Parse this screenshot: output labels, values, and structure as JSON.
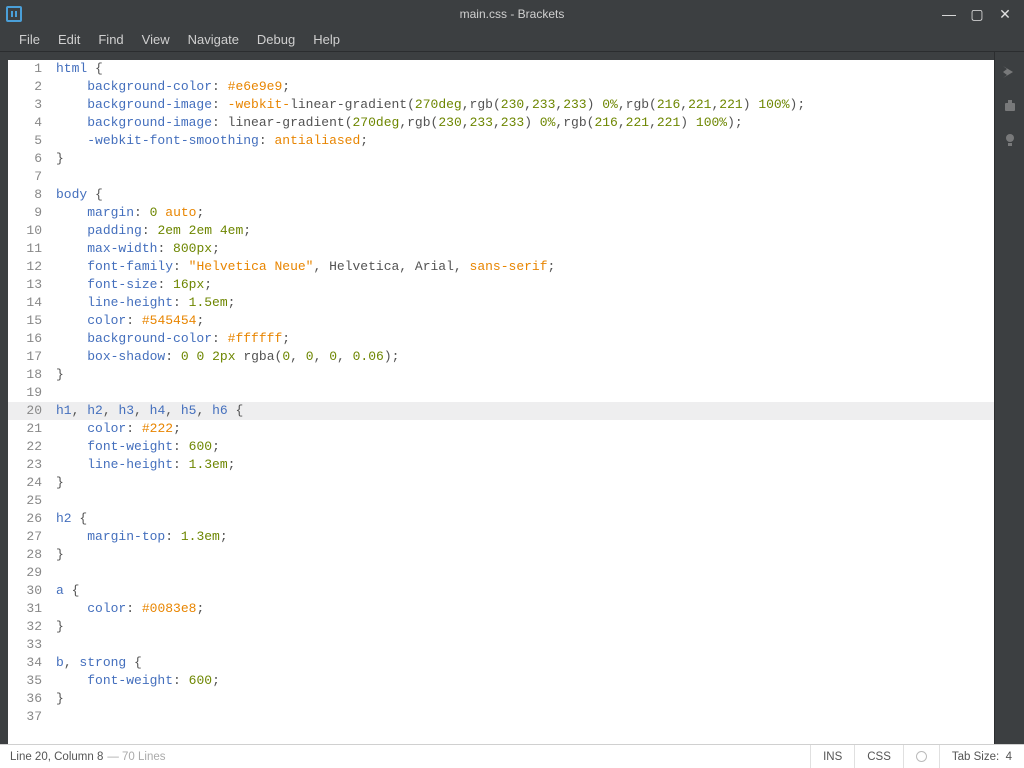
{
  "window": {
    "title": "main.css - Brackets"
  },
  "menu": [
    "File",
    "Edit",
    "Find",
    "View",
    "Navigate",
    "Debug",
    "Help"
  ],
  "side_icons": [
    "live-preview-icon",
    "extensions-icon",
    "lightbulb-icon"
  ],
  "status": {
    "cursor": "Line 20, Column 8",
    "lines_suffix": " — 70 Lines",
    "ins": "INS",
    "lang": "CSS",
    "tabsize_label": "Tab Size:",
    "tabsize_value": "4"
  },
  "editor": {
    "active_line": 20,
    "total_displayed": 37,
    "code": [
      [
        [
          "tag",
          "html"
        ],
        [
          "punc",
          " {"
        ]
      ],
      [
        [
          "punc",
          "    "
        ],
        [
          "prop",
          "background-color"
        ],
        [
          "punc",
          ": "
        ],
        [
          "atom",
          "#e6e9e9"
        ],
        [
          "punc",
          ";"
        ]
      ],
      [
        [
          "punc",
          "    "
        ],
        [
          "prop",
          "background-image"
        ],
        [
          "punc",
          ": "
        ],
        [
          "atom",
          "-webkit-"
        ],
        [
          "meta",
          "linear-gradient"
        ],
        [
          "punc",
          "("
        ],
        [
          "num",
          "270deg"
        ],
        [
          "punc",
          ","
        ],
        [
          "meta",
          "rgb"
        ],
        [
          "punc",
          "("
        ],
        [
          "num",
          "230"
        ],
        [
          "punc",
          ","
        ],
        [
          "num",
          "233"
        ],
        [
          "punc",
          ","
        ],
        [
          "num",
          "233"
        ],
        [
          "punc",
          ") "
        ],
        [
          "num",
          "0%"
        ],
        [
          "punc",
          ","
        ],
        [
          "meta",
          "rgb"
        ],
        [
          "punc",
          "("
        ],
        [
          "num",
          "216"
        ],
        [
          "punc",
          ","
        ],
        [
          "num",
          "221"
        ],
        [
          "punc",
          ","
        ],
        [
          "num",
          "221"
        ],
        [
          "punc",
          ") "
        ],
        [
          "num",
          "100%"
        ],
        [
          "punc",
          ");"
        ]
      ],
      [
        [
          "punc",
          "    "
        ],
        [
          "prop",
          "background-image"
        ],
        [
          "punc",
          ": "
        ],
        [
          "meta",
          "linear-gradient"
        ],
        [
          "punc",
          "("
        ],
        [
          "num",
          "270deg"
        ],
        [
          "punc",
          ","
        ],
        [
          "meta",
          "rgb"
        ],
        [
          "punc",
          "("
        ],
        [
          "num",
          "230"
        ],
        [
          "punc",
          ","
        ],
        [
          "num",
          "233"
        ],
        [
          "punc",
          ","
        ],
        [
          "num",
          "233"
        ],
        [
          "punc",
          ") "
        ],
        [
          "num",
          "0%"
        ],
        [
          "punc",
          ","
        ],
        [
          "meta",
          "rgb"
        ],
        [
          "punc",
          "("
        ],
        [
          "num",
          "216"
        ],
        [
          "punc",
          ","
        ],
        [
          "num",
          "221"
        ],
        [
          "punc",
          ","
        ],
        [
          "num",
          "221"
        ],
        [
          "punc",
          ") "
        ],
        [
          "num",
          "100%"
        ],
        [
          "punc",
          ");"
        ]
      ],
      [
        [
          "punc",
          "    "
        ],
        [
          "prop",
          "-webkit-font-smoothing"
        ],
        [
          "punc",
          ": "
        ],
        [
          "atom",
          "antialiased"
        ],
        [
          "punc",
          ";"
        ]
      ],
      [
        [
          "punc",
          "}"
        ]
      ],
      [],
      [
        [
          "tag",
          "body"
        ],
        [
          "punc",
          " {"
        ]
      ],
      [
        [
          "punc",
          "    "
        ],
        [
          "prop",
          "margin"
        ],
        [
          "punc",
          ": "
        ],
        [
          "num",
          "0"
        ],
        [
          "punc",
          " "
        ],
        [
          "atom",
          "auto"
        ],
        [
          "punc",
          ";"
        ]
      ],
      [
        [
          "punc",
          "    "
        ],
        [
          "prop",
          "padding"
        ],
        [
          "punc",
          ": "
        ],
        [
          "num",
          "2em"
        ],
        [
          "punc",
          " "
        ],
        [
          "num",
          "2em"
        ],
        [
          "punc",
          " "
        ],
        [
          "num",
          "4em"
        ],
        [
          "punc",
          ";"
        ]
      ],
      [
        [
          "punc",
          "    "
        ],
        [
          "prop",
          "max-width"
        ],
        [
          "punc",
          ": "
        ],
        [
          "num",
          "800px"
        ],
        [
          "punc",
          ";"
        ]
      ],
      [
        [
          "punc",
          "    "
        ],
        [
          "prop",
          "font-family"
        ],
        [
          "punc",
          ": "
        ],
        [
          "str",
          "\"Helvetica Neue\""
        ],
        [
          "punc",
          ", Helvetica, Arial, "
        ],
        [
          "atom",
          "sans-serif"
        ],
        [
          "punc",
          ";"
        ]
      ],
      [
        [
          "punc",
          "    "
        ],
        [
          "prop",
          "font-size"
        ],
        [
          "punc",
          ": "
        ],
        [
          "num",
          "16px"
        ],
        [
          "punc",
          ";"
        ]
      ],
      [
        [
          "punc",
          "    "
        ],
        [
          "prop",
          "line-height"
        ],
        [
          "punc",
          ": "
        ],
        [
          "num",
          "1.5em"
        ],
        [
          "punc",
          ";"
        ]
      ],
      [
        [
          "punc",
          "    "
        ],
        [
          "prop",
          "color"
        ],
        [
          "punc",
          ": "
        ],
        [
          "atom",
          "#545454"
        ],
        [
          "punc",
          ";"
        ]
      ],
      [
        [
          "punc",
          "    "
        ],
        [
          "prop",
          "background-color"
        ],
        [
          "punc",
          ": "
        ],
        [
          "atom",
          "#ffffff"
        ],
        [
          "punc",
          ";"
        ]
      ],
      [
        [
          "punc",
          "    "
        ],
        [
          "prop",
          "box-shadow"
        ],
        [
          "punc",
          ": "
        ],
        [
          "num",
          "0"
        ],
        [
          "punc",
          " "
        ],
        [
          "num",
          "0"
        ],
        [
          "punc",
          " "
        ],
        [
          "num",
          "2px"
        ],
        [
          "punc",
          " "
        ],
        [
          "meta",
          "rgba"
        ],
        [
          "punc",
          "("
        ],
        [
          "num",
          "0"
        ],
        [
          "punc",
          ", "
        ],
        [
          "num",
          "0"
        ],
        [
          "punc",
          ", "
        ],
        [
          "num",
          "0"
        ],
        [
          "punc",
          ", "
        ],
        [
          "num",
          "0.06"
        ],
        [
          "punc",
          ");"
        ]
      ],
      [
        [
          "punc",
          "}"
        ]
      ],
      [],
      [
        [
          "tag",
          "h1"
        ],
        [
          "punc",
          ", "
        ],
        [
          "tag",
          "h2"
        ],
        [
          "punc",
          ", "
        ],
        [
          "tag",
          "h3"
        ],
        [
          "punc",
          ", "
        ],
        [
          "tag",
          "h4"
        ],
        [
          "punc",
          ", "
        ],
        [
          "tag",
          "h5"
        ],
        [
          "punc",
          ", "
        ],
        [
          "tag",
          "h6"
        ],
        [
          "punc",
          " {"
        ]
      ],
      [
        [
          "punc",
          "    "
        ],
        [
          "prop",
          "color"
        ],
        [
          "punc",
          ": "
        ],
        [
          "atom",
          "#222"
        ],
        [
          "punc",
          ";"
        ]
      ],
      [
        [
          "punc",
          "    "
        ],
        [
          "prop",
          "font-weight"
        ],
        [
          "punc",
          ": "
        ],
        [
          "num",
          "600"
        ],
        [
          "punc",
          ";"
        ]
      ],
      [
        [
          "punc",
          "    "
        ],
        [
          "prop",
          "line-height"
        ],
        [
          "punc",
          ": "
        ],
        [
          "num",
          "1.3em"
        ],
        [
          "punc",
          ";"
        ]
      ],
      [
        [
          "punc",
          "}"
        ]
      ],
      [],
      [
        [
          "tag",
          "h2"
        ],
        [
          "punc",
          " {"
        ]
      ],
      [
        [
          "punc",
          "    "
        ],
        [
          "prop",
          "margin-top"
        ],
        [
          "punc",
          ": "
        ],
        [
          "num",
          "1.3em"
        ],
        [
          "punc",
          ";"
        ]
      ],
      [
        [
          "punc",
          "}"
        ]
      ],
      [],
      [
        [
          "tag",
          "a"
        ],
        [
          "punc",
          " {"
        ]
      ],
      [
        [
          "punc",
          "    "
        ],
        [
          "prop",
          "color"
        ],
        [
          "punc",
          ": "
        ],
        [
          "atom",
          "#0083e8"
        ],
        [
          "punc",
          ";"
        ]
      ],
      [
        [
          "punc",
          "}"
        ]
      ],
      [],
      [
        [
          "tag",
          "b"
        ],
        [
          "punc",
          ", "
        ],
        [
          "tag",
          "strong"
        ],
        [
          "punc",
          " {"
        ]
      ],
      [
        [
          "punc",
          "    "
        ],
        [
          "prop",
          "font-weight"
        ],
        [
          "punc",
          ": "
        ],
        [
          "num",
          "600"
        ],
        [
          "punc",
          ";"
        ]
      ],
      [
        [
          "punc",
          "}"
        ]
      ],
      []
    ]
  }
}
